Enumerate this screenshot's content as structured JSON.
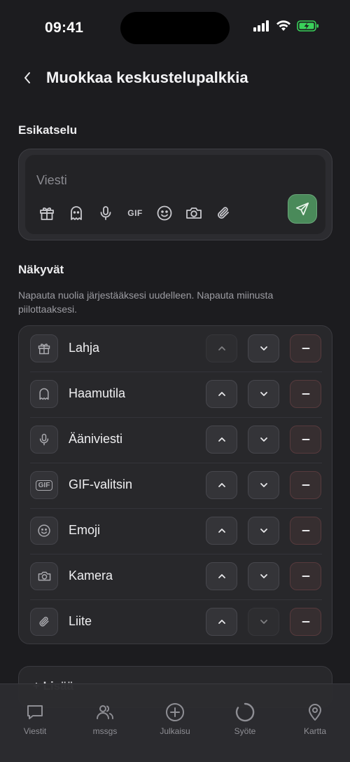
{
  "status_bar": {
    "time": "09:41"
  },
  "header": {
    "title": "Muokkaa keskustelupalkkia"
  },
  "preview": {
    "section_label": "Esikatselu",
    "placeholder": "Viesti",
    "icons": [
      "gift-icon",
      "ghost-icon",
      "microphone-icon",
      "gif-icon",
      "emoji-icon",
      "camera-icon",
      "paperclip-icon"
    ],
    "gif_label": "GIF",
    "accent_color": "#4a8a5a"
  },
  "visible": {
    "section_label": "Näkyvät",
    "hint": "Napauta nuolia järjestääksesi uudelleen. Napauta miinusta piilottaaksesi.",
    "items": [
      {
        "label": "Lahja",
        "icon": "gift-icon",
        "up_enabled": false,
        "down_enabled": true
      },
      {
        "label": "Haamutila",
        "icon": "ghost-icon",
        "up_enabled": true,
        "down_enabled": true
      },
      {
        "label": "Ääniviesti",
        "icon": "microphone-icon",
        "up_enabled": true,
        "down_enabled": true
      },
      {
        "label": "GIF-valitsin",
        "icon": "gif-icon",
        "icon_text": "GIF",
        "up_enabled": true,
        "down_enabled": true
      },
      {
        "label": "Emoji",
        "icon": "emoji-icon",
        "up_enabled": true,
        "down_enabled": true
      },
      {
        "label": "Kamera",
        "icon": "camera-icon",
        "up_enabled": true,
        "down_enabled": true
      },
      {
        "label": "Liite",
        "icon": "paperclip-icon",
        "up_enabled": true,
        "down_enabled": false
      }
    ]
  },
  "next_card": {
    "label": "+ Lisää"
  },
  "tabbar": {
    "tabs": [
      {
        "label": "Viestit",
        "icon": "chat-bubble-icon"
      },
      {
        "label": "mssgs",
        "icon": "people-icon"
      },
      {
        "label": "Julkaisu",
        "icon": "plus-circle-icon"
      },
      {
        "label": "Syöte",
        "icon": "feed-circle-icon"
      },
      {
        "label": "Kartta",
        "icon": "map-pin-icon"
      }
    ]
  }
}
